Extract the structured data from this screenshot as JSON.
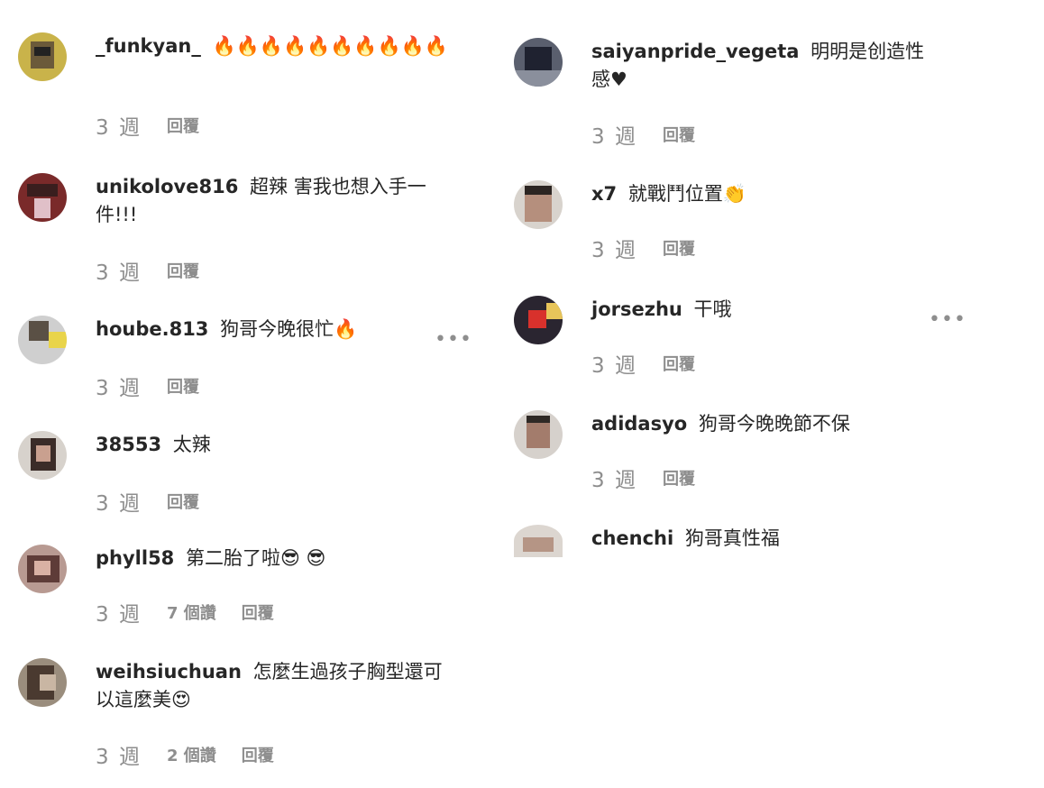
{
  "colors": {
    "text": "#262626",
    "meta": "#8e8e8e",
    "background": "#ffffff"
  },
  "more_icon": "ellipsis-icon",
  "left_comments": [
    {
      "username": "_funkyan_",
      "text": "🔥🔥🔥🔥🔥🔥🔥🔥🔥🔥",
      "time": "3 週",
      "likes": "",
      "reply": "回覆"
    },
    {
      "username": "unikolove816",
      "text": "超辣 害我也想入手一件!!!",
      "time": "3 週",
      "likes": "",
      "reply": "回覆"
    },
    {
      "username": "hoube.813",
      "text": "狗哥今晚很忙🔥",
      "time": "3 週",
      "likes": "",
      "reply": "回覆"
    },
    {
      "username": "38553",
      "text": "太辣",
      "time": "3 週",
      "likes": "",
      "reply": "回覆"
    },
    {
      "username": "phyll58",
      "text": "第二胎了啦😎 😎",
      "time": "3 週",
      "likes": "7 個讚",
      "reply": "回覆"
    },
    {
      "username": "weihsiuchuan",
      "text": "怎麼生過孩子胸型還可以這麼美😍",
      "time": "3 週",
      "likes": "2 個讚",
      "reply": "回覆"
    }
  ],
  "right_comments": [
    {
      "username": "saiyanpride_vegeta",
      "text": "明明是创造性感♥",
      "time": "3 週",
      "likes": "",
      "reply": "回覆"
    },
    {
      "username": "x7",
      "text": "就戰鬥位置👏",
      "time": "3 週",
      "likes": "",
      "reply": "回覆"
    },
    {
      "username": "jorsezhu",
      "text": "干哦",
      "time": "3 週",
      "likes": "",
      "reply": "回覆"
    },
    {
      "username": "adidasyo",
      "text": "狗哥今晚晚節不保",
      "time": "3 週",
      "likes": "",
      "reply": "回覆"
    },
    {
      "username": "chenchi",
      "text": "狗哥真性福",
      "time": "",
      "likes": "",
      "reply": ""
    }
  ]
}
